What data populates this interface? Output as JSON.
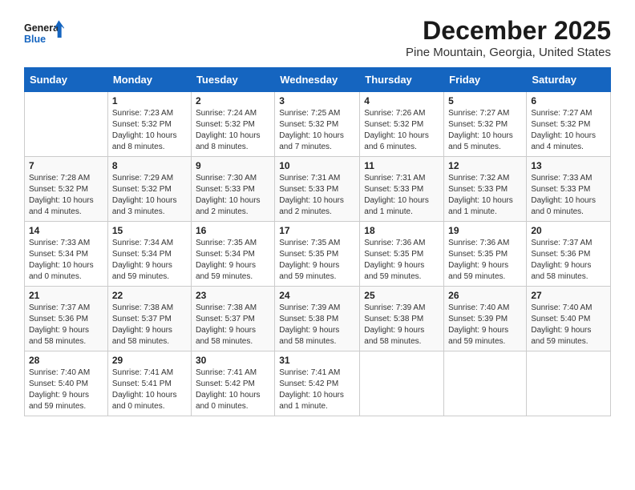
{
  "logo": {
    "line1": "General",
    "line2": "Blue",
    "icon_color": "#1565C0"
  },
  "title": "December 2025",
  "location": "Pine Mountain, Georgia, United States",
  "days_header": [
    "Sunday",
    "Monday",
    "Tuesday",
    "Wednesday",
    "Thursday",
    "Friday",
    "Saturday"
  ],
  "weeks": [
    [
      {
        "num": "",
        "info": ""
      },
      {
        "num": "1",
        "info": "Sunrise: 7:23 AM\nSunset: 5:32 PM\nDaylight: 10 hours\nand 8 minutes."
      },
      {
        "num": "2",
        "info": "Sunrise: 7:24 AM\nSunset: 5:32 PM\nDaylight: 10 hours\nand 8 minutes."
      },
      {
        "num": "3",
        "info": "Sunrise: 7:25 AM\nSunset: 5:32 PM\nDaylight: 10 hours\nand 7 minutes."
      },
      {
        "num": "4",
        "info": "Sunrise: 7:26 AM\nSunset: 5:32 PM\nDaylight: 10 hours\nand 6 minutes."
      },
      {
        "num": "5",
        "info": "Sunrise: 7:27 AM\nSunset: 5:32 PM\nDaylight: 10 hours\nand 5 minutes."
      },
      {
        "num": "6",
        "info": "Sunrise: 7:27 AM\nSunset: 5:32 PM\nDaylight: 10 hours\nand 4 minutes."
      }
    ],
    [
      {
        "num": "7",
        "info": "Sunrise: 7:28 AM\nSunset: 5:32 PM\nDaylight: 10 hours\nand 4 minutes."
      },
      {
        "num": "8",
        "info": "Sunrise: 7:29 AM\nSunset: 5:32 PM\nDaylight: 10 hours\nand 3 minutes."
      },
      {
        "num": "9",
        "info": "Sunrise: 7:30 AM\nSunset: 5:33 PM\nDaylight: 10 hours\nand 2 minutes."
      },
      {
        "num": "10",
        "info": "Sunrise: 7:31 AM\nSunset: 5:33 PM\nDaylight: 10 hours\nand 2 minutes."
      },
      {
        "num": "11",
        "info": "Sunrise: 7:31 AM\nSunset: 5:33 PM\nDaylight: 10 hours\nand 1 minute."
      },
      {
        "num": "12",
        "info": "Sunrise: 7:32 AM\nSunset: 5:33 PM\nDaylight: 10 hours\nand 1 minute."
      },
      {
        "num": "13",
        "info": "Sunrise: 7:33 AM\nSunset: 5:33 PM\nDaylight: 10 hours\nand 0 minutes."
      }
    ],
    [
      {
        "num": "14",
        "info": "Sunrise: 7:33 AM\nSunset: 5:34 PM\nDaylight: 10 hours\nand 0 minutes."
      },
      {
        "num": "15",
        "info": "Sunrise: 7:34 AM\nSunset: 5:34 PM\nDaylight: 9 hours\nand 59 minutes."
      },
      {
        "num": "16",
        "info": "Sunrise: 7:35 AM\nSunset: 5:34 PM\nDaylight: 9 hours\nand 59 minutes."
      },
      {
        "num": "17",
        "info": "Sunrise: 7:35 AM\nSunset: 5:35 PM\nDaylight: 9 hours\nand 59 minutes."
      },
      {
        "num": "18",
        "info": "Sunrise: 7:36 AM\nSunset: 5:35 PM\nDaylight: 9 hours\nand 59 minutes."
      },
      {
        "num": "19",
        "info": "Sunrise: 7:36 AM\nSunset: 5:35 PM\nDaylight: 9 hours\nand 59 minutes."
      },
      {
        "num": "20",
        "info": "Sunrise: 7:37 AM\nSunset: 5:36 PM\nDaylight: 9 hours\nand 58 minutes."
      }
    ],
    [
      {
        "num": "21",
        "info": "Sunrise: 7:37 AM\nSunset: 5:36 PM\nDaylight: 9 hours\nand 58 minutes."
      },
      {
        "num": "22",
        "info": "Sunrise: 7:38 AM\nSunset: 5:37 PM\nDaylight: 9 hours\nand 58 minutes."
      },
      {
        "num": "23",
        "info": "Sunrise: 7:38 AM\nSunset: 5:37 PM\nDaylight: 9 hours\nand 58 minutes."
      },
      {
        "num": "24",
        "info": "Sunrise: 7:39 AM\nSunset: 5:38 PM\nDaylight: 9 hours\nand 58 minutes."
      },
      {
        "num": "25",
        "info": "Sunrise: 7:39 AM\nSunset: 5:38 PM\nDaylight: 9 hours\nand 58 minutes."
      },
      {
        "num": "26",
        "info": "Sunrise: 7:40 AM\nSunset: 5:39 PM\nDaylight: 9 hours\nand 59 minutes."
      },
      {
        "num": "27",
        "info": "Sunrise: 7:40 AM\nSunset: 5:40 PM\nDaylight: 9 hours\nand 59 minutes."
      }
    ],
    [
      {
        "num": "28",
        "info": "Sunrise: 7:40 AM\nSunset: 5:40 PM\nDaylight: 9 hours\nand 59 minutes."
      },
      {
        "num": "29",
        "info": "Sunrise: 7:41 AM\nSunset: 5:41 PM\nDaylight: 10 hours\nand 0 minutes."
      },
      {
        "num": "30",
        "info": "Sunrise: 7:41 AM\nSunset: 5:42 PM\nDaylight: 10 hours\nand 0 minutes."
      },
      {
        "num": "31",
        "info": "Sunrise: 7:41 AM\nSunset: 5:42 PM\nDaylight: 10 hours\nand 1 minute."
      },
      {
        "num": "",
        "info": ""
      },
      {
        "num": "",
        "info": ""
      },
      {
        "num": "",
        "info": ""
      }
    ]
  ]
}
